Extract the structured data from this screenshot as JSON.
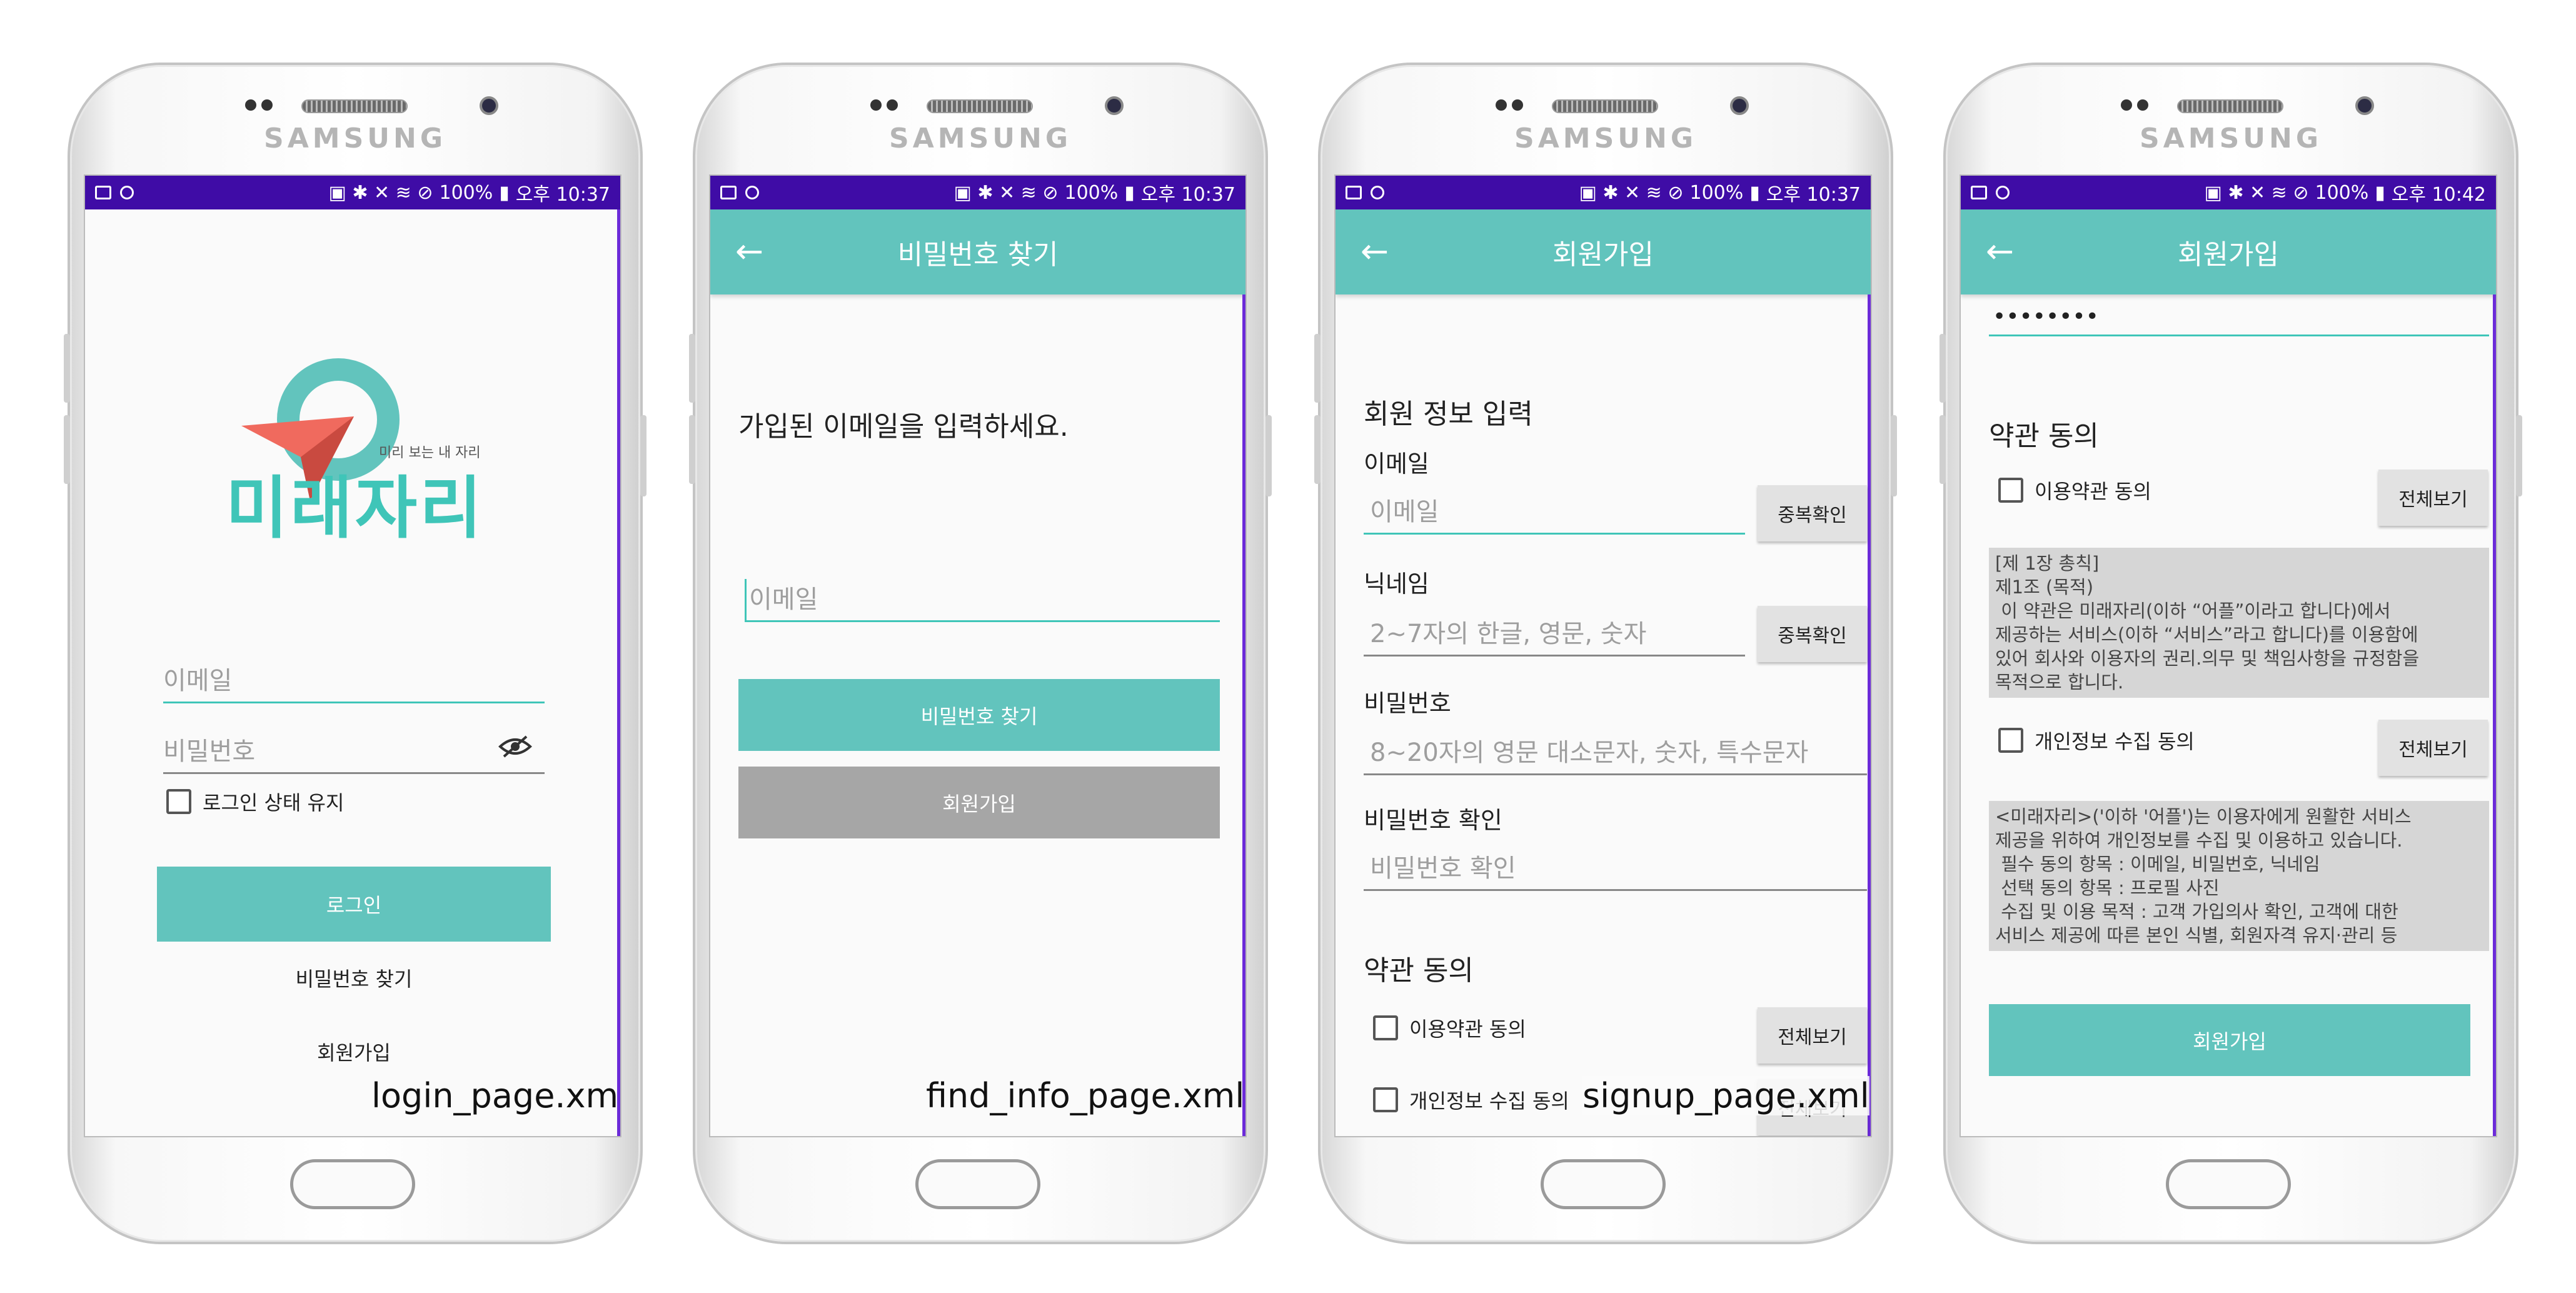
{
  "brand": "SAMSUNG",
  "status": {
    "battery": "100%",
    "time_a": "오후 10:37",
    "time_b": "오후 10:42"
  },
  "login": {
    "logo_main": "미래자리",
    "logo_tagline": "미리 보는 내 자리",
    "email_placeholder": "이메일",
    "password_placeholder": "비밀번호",
    "keep_login": "로그인 상태 유지",
    "login_button": "로그인",
    "find_password": "비밀번호 찾기",
    "signup": "회원가입",
    "caption": "login_page.xml"
  },
  "find": {
    "title": "비밀번호 찾기",
    "instruction": "가입된 이메일을 입력하세요.",
    "email_placeholder": "이메일",
    "find_button": "비밀번호 찾기",
    "signup_button": "회원가입",
    "caption": "find_info_page.xml"
  },
  "signup": {
    "title": "회원가입",
    "section_info": "회원 정보 입력",
    "email_label": "이메일",
    "email_placeholder": "이메일",
    "dup_check": "중복확인",
    "nickname_label": "닉네임",
    "nickname_placeholder": "2~7자의 한글, 영문, 숫자",
    "password_label": "비밀번호",
    "password_placeholder": "8~20자의 영문 대소문자, 숫자, 특수문자",
    "password_confirm_label": "비밀번호 확인",
    "password_confirm_placeholder": "비밀번호 확인",
    "section_terms": "약관 동의",
    "terms_agree": "이용약관 동의",
    "privacy_agree": "개인정보 수집 동의",
    "view_all": "전체보기",
    "caption": "signup_page.xml"
  },
  "signup2": {
    "title": "회원가입",
    "password_value": "••••••••",
    "section_terms": "약관 동의",
    "terms_agree": "이용약관 동의",
    "privacy_agree": "개인정보 수집 동의",
    "view_all": "전체보기",
    "terms_text": "[제 1장 총칙]\n제1조 (목적)\n 이 약관은 미래자리(이하 “어플”이라고 합니다)에서\n제공하는 서비스(이하 “서비스”라고 합니다)를 이용함에\n있어 회사와 이용자의 권리.의무 및 책임사항을 규정함을\n목적으로 합니다.",
    "privacy_text": "<미래자리>('이하 '어플')는 이용자에게 원활한 서비스\n제공을 위하여 개인정보를 수집 및 이용하고 있습니다.\n 필수 동의 항목 : 이메일, 비밀번호, 닉네임\n 선택 동의 항목 : 프로필 사진\n 수집 및 이용 목적 : 고객 가입의사 확인, 고객에 대한\n서비스 제공에 따른 본인 식별, 회원자격 유지·관리 등",
    "signup_button": "회원가입"
  },
  "colors": {
    "teal": "#62c4bd",
    "status_bar": "#3f0ca6",
    "logo_red": "#f06a5e"
  }
}
